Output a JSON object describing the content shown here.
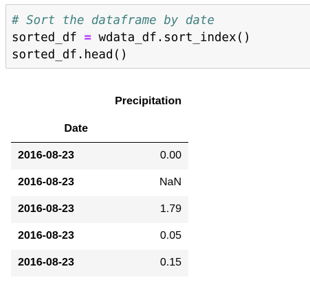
{
  "code_cell": {
    "comment": "# Sort the dataframe by date",
    "line2_var": "sorted_df ",
    "line2_op": "=",
    "line2_rest": " wdata_df.sort_index()",
    "line3": "sorted_df.head()"
  },
  "table": {
    "column_header": "Precipitation",
    "index_name": "Date",
    "rows": [
      {
        "date": "2016-08-23",
        "value": "0.00"
      },
      {
        "date": "2016-08-23",
        "value": "NaN"
      },
      {
        "date": "2016-08-23",
        "value": "1.79"
      },
      {
        "date": "2016-08-23",
        "value": "0.05"
      },
      {
        "date": "2016-08-23",
        "value": "0.15"
      }
    ]
  }
}
